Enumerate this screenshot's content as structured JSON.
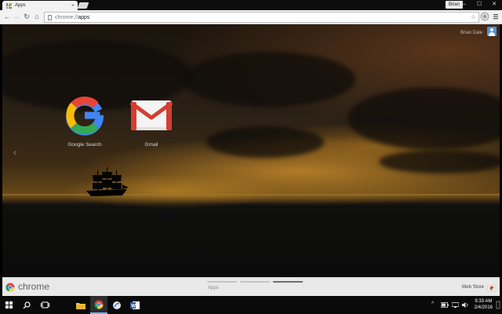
{
  "window": {
    "tab_title": "Apps",
    "tab_close": "×",
    "profile_name": "Brian",
    "minimize": "–",
    "maximize": "☐",
    "close": "✕"
  },
  "toolbar": {
    "back": "←",
    "forward": "→",
    "reload": "↻",
    "home": "⌂",
    "url_scheme": "chrome://",
    "url_host": "apps",
    "bookmark_star": "☆"
  },
  "ntp": {
    "user_name": "Brian Dale",
    "prev_arrow": "‹",
    "apps": [
      {
        "label": "Google Search",
        "icon": "google-g-icon"
      },
      {
        "label": "Gmail",
        "icon": "gmail-icon"
      }
    ],
    "footer": {
      "brand": "chrome",
      "page_label": "Apps",
      "webstore_label": "Web Store",
      "pages_count": 3,
      "active_page": 2
    }
  },
  "taskbar": {
    "icons": [
      "windows-start-icon",
      "search-icon",
      "task-view-icon",
      "file-explorer-icon",
      "chrome-icon",
      "app-icon",
      "word-icon"
    ],
    "tray_up": "^",
    "time": "9:33 AM",
    "date": "2/4/2016"
  },
  "colors": {
    "google_blue": "#4285F4",
    "google_red": "#EA4335",
    "google_yellow": "#FBBC05",
    "google_green": "#34A853",
    "gmail_red": "#D23F31",
    "taskbar_accent": "#7DB0E8"
  }
}
